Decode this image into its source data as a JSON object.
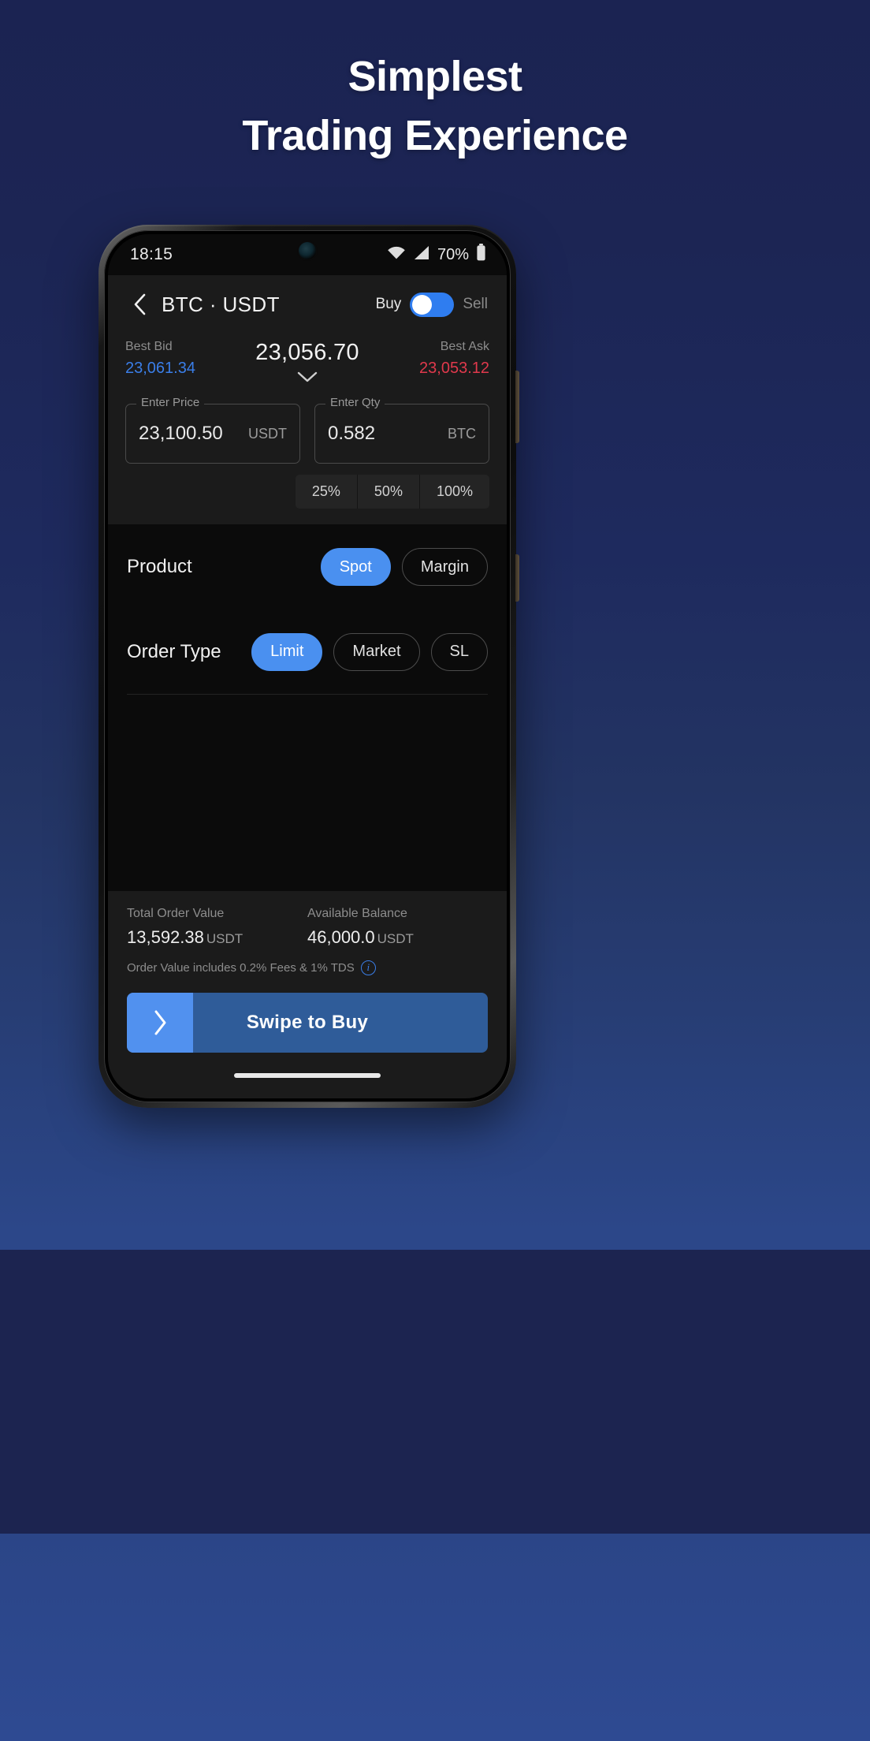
{
  "promo": {
    "headline_line1": "Simplest",
    "headline_line2": "Trading Experience",
    "bg_top_color": "#1b2352",
    "bg_mid_color": "#2c4789",
    "bg_band_color": "#1c2450"
  },
  "status_bar": {
    "time": "18:15",
    "battery_percent": "70%",
    "wifi_icon": "wifi-icon",
    "signal_icon": "cellular-signal-icon",
    "battery_icon": "battery-icon",
    "camera_icon": "front-camera-icon"
  },
  "app_header": {
    "back_icon": "back-chevron-icon",
    "pair_title": "BTC · USDT",
    "buy_label": "Buy",
    "sell_label": "Sell",
    "toggle_state": "buy",
    "toggle_color": "#2f7df0"
  },
  "price": {
    "best_bid_label": "Best Bid",
    "best_bid_value": "23,061.34",
    "best_bid_color": "#3a7ee8",
    "mid_price": "23,056.70",
    "expand_icon": "chevron-down-icon",
    "best_ask_label": "Best Ask",
    "best_ask_value": "23,053.12",
    "best_ask_color": "#e0394c"
  },
  "inputs": {
    "price_legend": "Enter Price",
    "price_value": "23,100.50",
    "price_unit": "USDT",
    "qty_legend": "Enter Qty",
    "qty_value": "0.582",
    "qty_unit": "BTC"
  },
  "percent_buttons": [
    {
      "label": "25%"
    },
    {
      "label": "50%"
    },
    {
      "label": "100%"
    }
  ],
  "product": {
    "label": "Product",
    "options": [
      {
        "label": "Spot",
        "active": true
      },
      {
        "label": "Margin",
        "active": false
      }
    ]
  },
  "order_type": {
    "label": "Order Type",
    "options": [
      {
        "label": "Limit",
        "active": true
      },
      {
        "label": "Market",
        "active": false
      },
      {
        "label": "SL",
        "active": false
      }
    ]
  },
  "summary": {
    "total_order_value_label": "Total Order Value",
    "total_order_value": "13,592.38",
    "total_order_value_unit": "USDT",
    "available_balance_label": "Available Balance",
    "available_balance": "46,000.0",
    "available_balance_unit": "USDT",
    "fee_note": "Order Value includes 0.2% Fees & 1% TDS",
    "info_icon": "info-icon",
    "info_icon_color": "#3a7ee8"
  },
  "swipe_action": {
    "label": "Swipe to Buy",
    "handle_icon": "chevron-right-icon",
    "handle_color": "#5191ef",
    "track_color": "#2f5c99"
  },
  "system_nav": {
    "home_indicator": "home-indicator"
  }
}
